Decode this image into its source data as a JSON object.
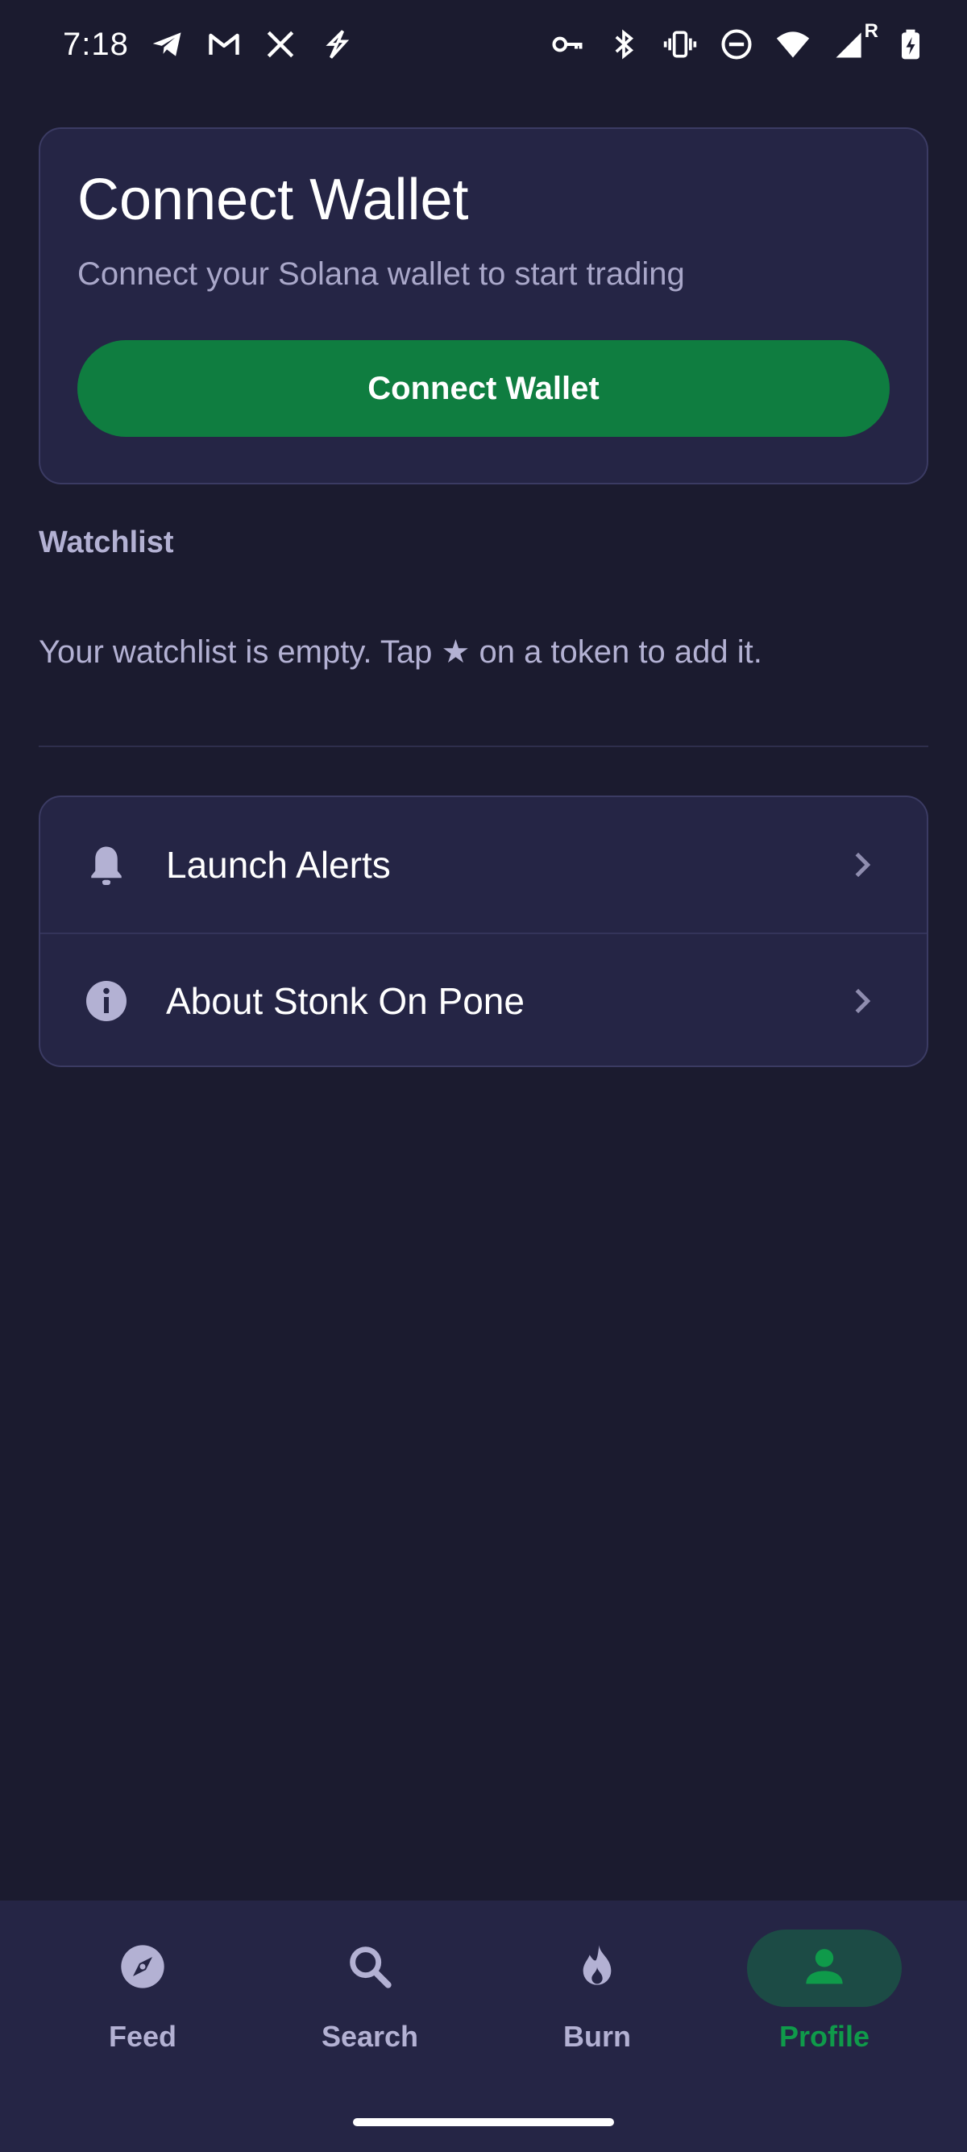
{
  "status_bar": {
    "time": "7:18",
    "network_label": "R",
    "left_icons": [
      "telegram-icon",
      "gmail-icon",
      "x-icon",
      "bolt-app-icon"
    ],
    "right_icons": [
      "vpn-key-icon",
      "bluetooth-icon",
      "vibrate-icon",
      "do-not-disturb-icon",
      "wifi-icon",
      "signal-icon",
      "battery-charging-icon"
    ]
  },
  "wallet": {
    "title": "Connect Wallet",
    "subtitle": "Connect your Solana wallet to start trading",
    "button_label": "Connect Wallet"
  },
  "watchlist": {
    "section_label": "Watchlist",
    "empty_text": "Your watchlist is empty. Tap ★ on a token to add it."
  },
  "menu": {
    "items": [
      {
        "label": "Launch Alerts",
        "icon": "bell-icon"
      },
      {
        "label": "About Stonk On Pone",
        "icon": "info-icon"
      }
    ]
  },
  "nav": {
    "items": [
      {
        "label": "Feed",
        "icon": "compass-icon",
        "active": false
      },
      {
        "label": "Search",
        "icon": "search-icon",
        "active": false
      },
      {
        "label": "Burn",
        "icon": "flame-icon",
        "active": false
      },
      {
        "label": "Profile",
        "icon": "person-icon",
        "active": true
      }
    ]
  },
  "colors": {
    "background": "#1b1b2f",
    "card": "#252545",
    "accent_green": "#0f7d40",
    "active_nav": "#0f9a4a",
    "muted_text": "#b3b1d3"
  }
}
